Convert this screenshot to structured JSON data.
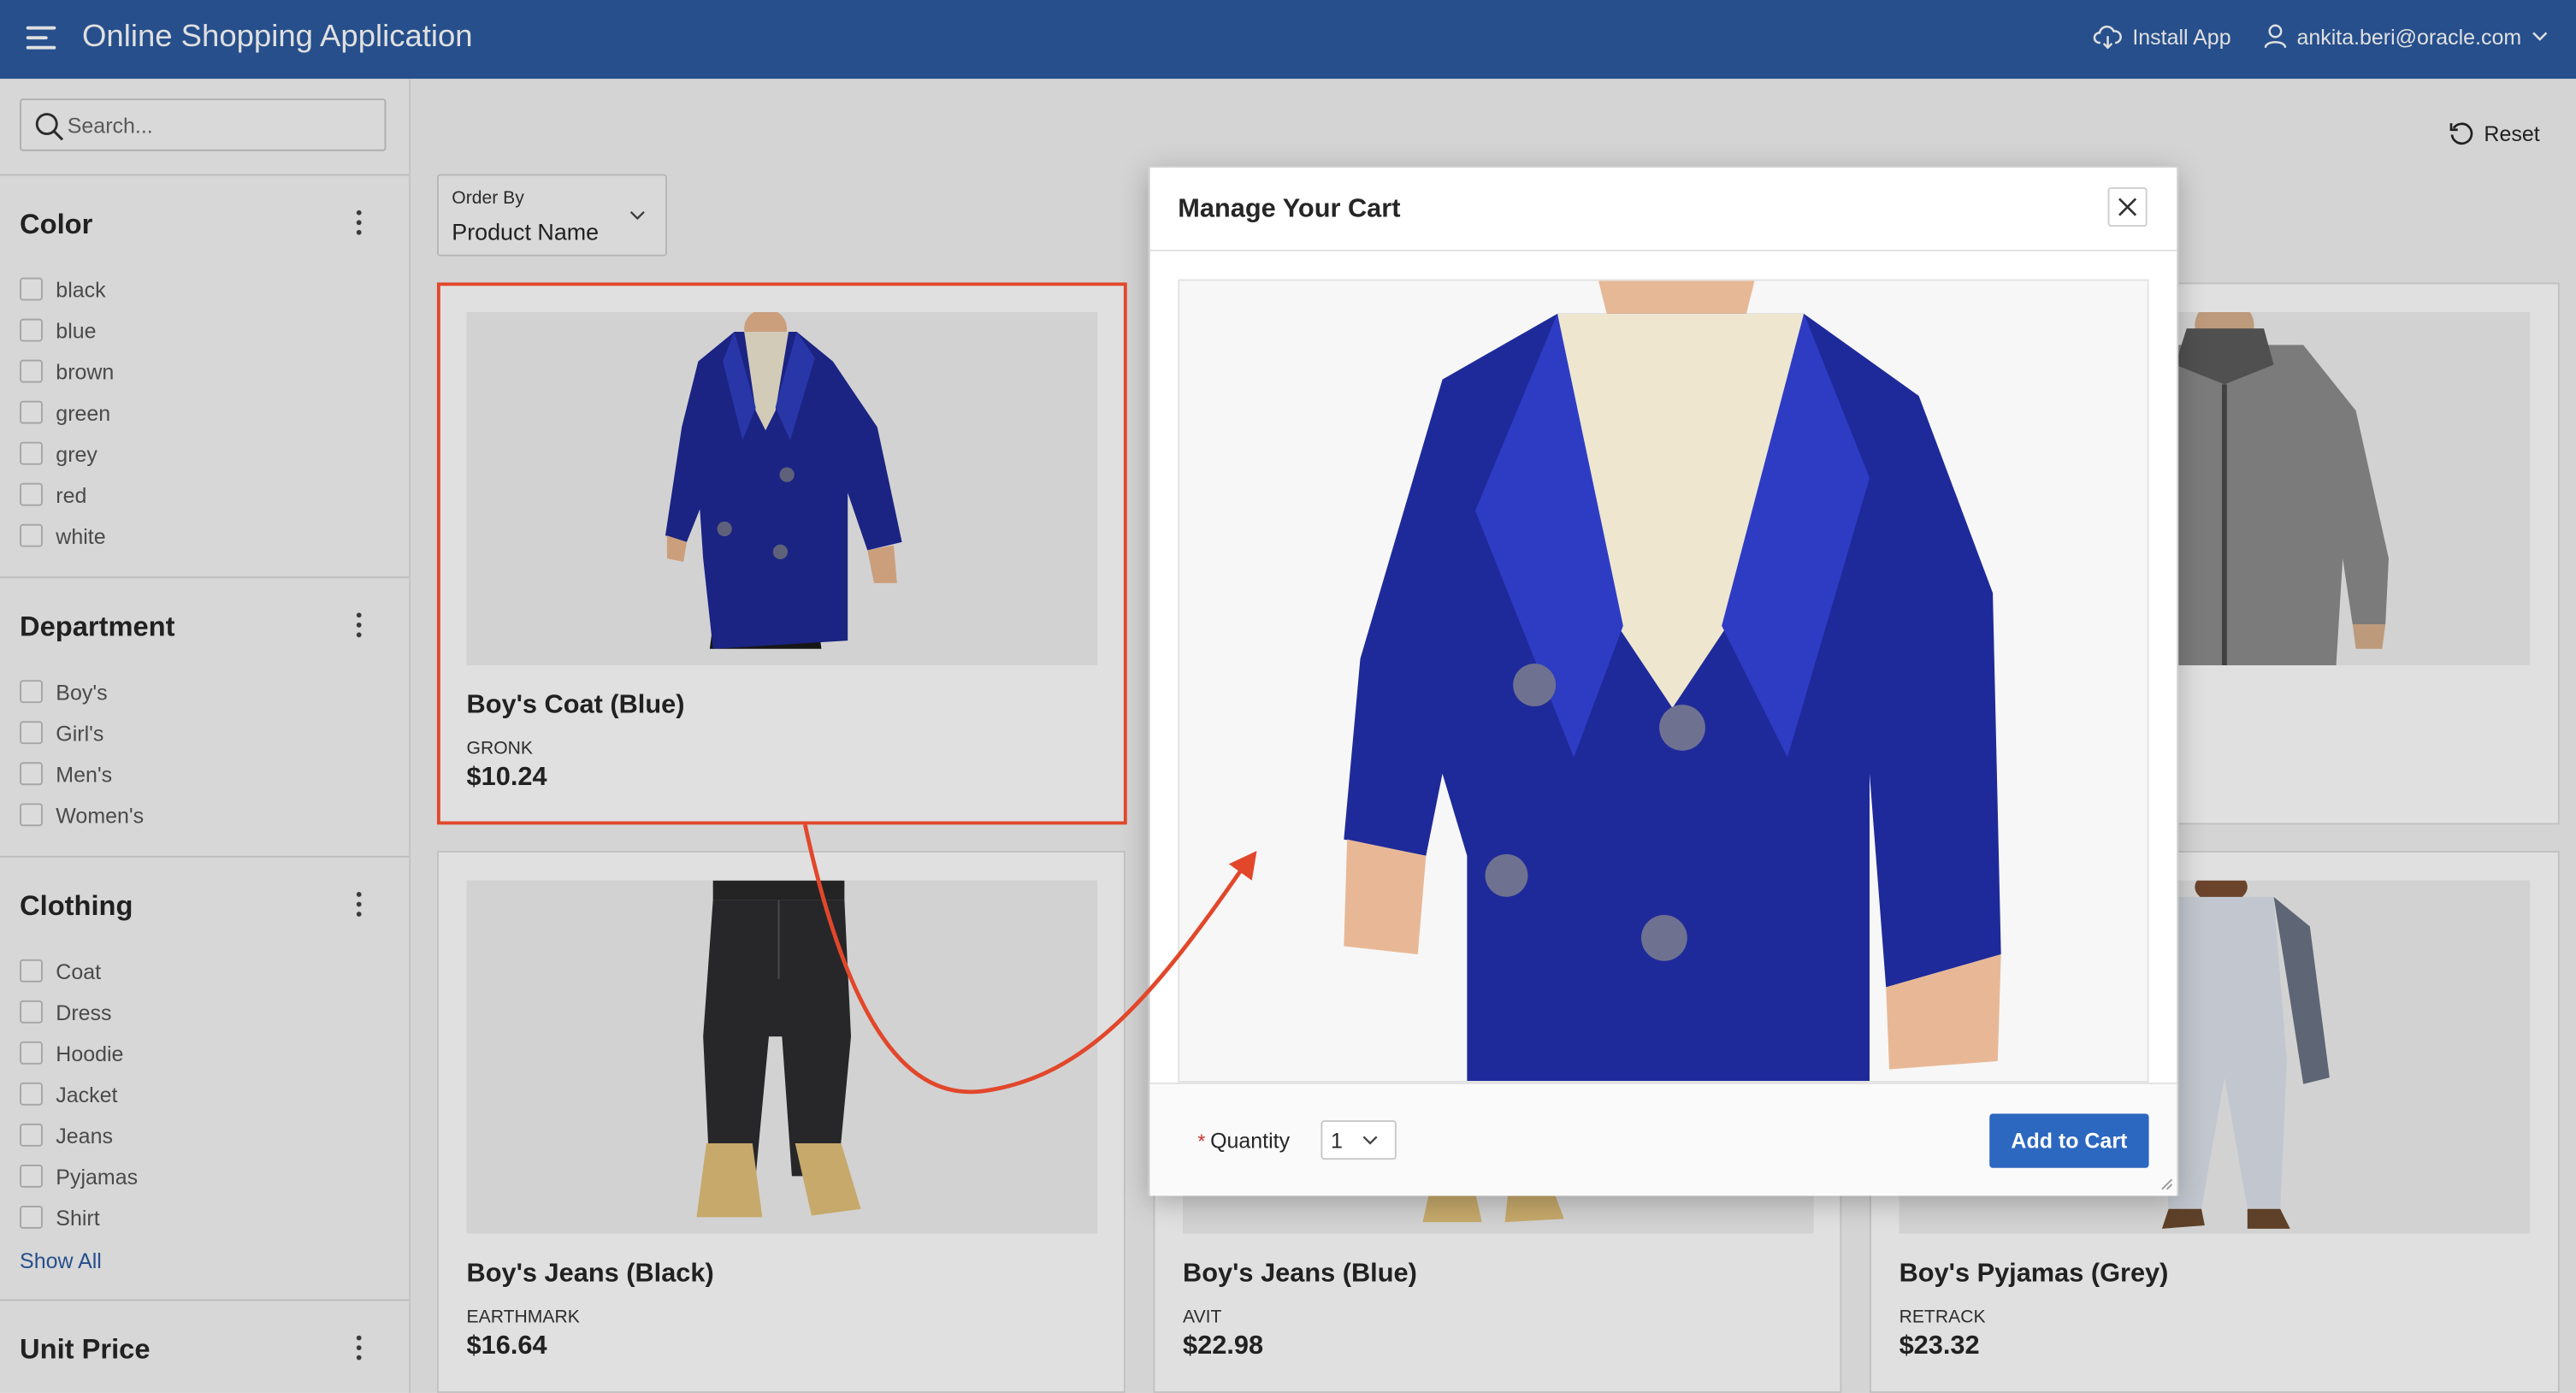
{
  "header": {
    "title": "Online Shopping Application",
    "install_label": "Install App",
    "user_email": "ankita.beri@oracle.com"
  },
  "sidebar": {
    "search_placeholder": "Search...",
    "facets": [
      {
        "title": "Color",
        "options": [
          "black",
          "blue",
          "brown",
          "green",
          "grey",
          "red",
          "white"
        ]
      },
      {
        "title": "Department",
        "options": [
          "Boy's",
          "Girl's",
          "Men's",
          "Women's"
        ]
      },
      {
        "title": "Clothing",
        "options": [
          "Coat",
          "Dress",
          "Hoodie",
          "Jacket",
          "Jeans",
          "Pyjamas",
          "Shirt"
        ],
        "show_all": "Show All"
      },
      {
        "title": "Unit Price",
        "options": []
      }
    ]
  },
  "main": {
    "reset_label": "Reset",
    "order_by": {
      "label": "Order By",
      "value": "Product Name"
    },
    "products": [
      {
        "name": "Boy's Coat (Blue)",
        "brand": "GRONK",
        "price": "$10.24"
      },
      {
        "name": "Boy's Jeans (Black)",
        "brand": "EARTHMARK",
        "price": "$16.64"
      },
      {
        "name": "Boy's Jeans (Blue)",
        "brand": "AVIT",
        "price": "$22.98"
      },
      {
        "name": "Boy's Pyjamas (Grey)",
        "brand": "RETRACK",
        "price": "$23.32"
      }
    ]
  },
  "dialog": {
    "title": "Manage Your Cart",
    "quantity_label": "Quantity",
    "quantity_value": "1",
    "add_button": "Add to Cart"
  },
  "colors": {
    "header_bg": "#2c5aa0",
    "button_bg": "#2c67c0",
    "annotation": "#e2472b",
    "coat_blue": "#1e2a9a"
  }
}
